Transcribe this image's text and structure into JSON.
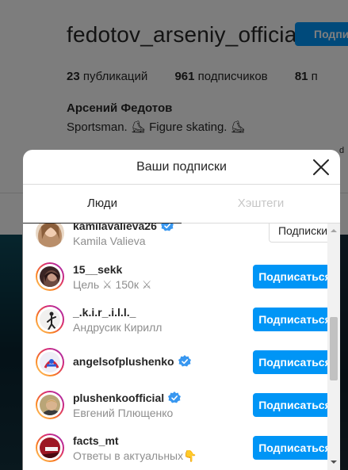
{
  "profile": {
    "username": "fedotov_arseniy_official",
    "follow_button": "Подпи",
    "stats": [
      {
        "count": "23",
        "label": "публикаций"
      },
      {
        "count": "961",
        "label": "подписчиков"
      },
      {
        "count": "81",
        "label": "п"
      }
    ],
    "full_name": "Арсений Федотов",
    "bio": "Sportsman. ⛸ Figure skating. ⛸",
    "stub_text": "d"
  },
  "modal": {
    "title": "Ваши подписки",
    "tabs": [
      {
        "label": "Люди",
        "active": true
      },
      {
        "label": "Хэштеги",
        "active": false
      }
    ],
    "accounts": [
      {
        "username": "kamilavalieva26",
        "name": "Kamila Valieva",
        "verified": true,
        "button": "Подписки",
        "following": true,
        "avatar_color": "#c9a27e"
      },
      {
        "username": "15__sekk",
        "name": "Цель ⚔ 150к ⚔",
        "verified": false,
        "button": "Подписаться",
        "following": false,
        "avatar_color": "#5b3b38"
      },
      {
        "username": "_.k.i.r_.i.l.l._",
        "name": "Андрусик Кирилл",
        "verified": false,
        "button": "Подписаться",
        "following": false,
        "avatar_color": "#e8e6e6"
      },
      {
        "username": "angelsofplushenko",
        "name": "",
        "verified": true,
        "button": "Подписаться",
        "following": false,
        "avatar_color": "#d9d9e8"
      },
      {
        "username": "plushenkoofficial",
        "name": "Евгений Плющенко",
        "verified": true,
        "button": "Подписаться",
        "following": false,
        "avatar_color": "#8c7a52"
      },
      {
        "username": "facts_mt",
        "name": "Ответы в актуальных👇",
        "verified": false,
        "button": "Подписаться",
        "following": false,
        "avatar_color": "#b01c28"
      }
    ]
  },
  "colors": {
    "accent": "#0095f6",
    "verified": "#3897f0"
  },
  "icons": {
    "close": "close-icon",
    "verified": "verified-badge-icon"
  }
}
